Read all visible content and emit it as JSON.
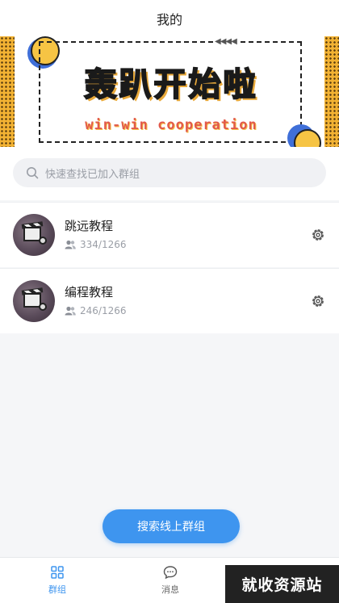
{
  "header": {
    "title": "我的"
  },
  "banner": {
    "headline": "轰趴开始啦",
    "subline": "win-win cooperation",
    "arrows": "◀◀◀◀"
  },
  "search": {
    "placeholder": "快速查找已加入群组"
  },
  "groups": [
    {
      "name": "跳远教程",
      "count": "334/1266",
      "icon": "film-clapper-avatar"
    },
    {
      "name": "编程教程",
      "count": "246/1266",
      "icon": "film-clapper-avatar"
    }
  ],
  "fab": {
    "label": "搜索线上群组"
  },
  "tabbar": {
    "items": [
      {
        "label": "群组",
        "icon": "grid-icon",
        "active": true
      },
      {
        "label": "消息",
        "icon": "chat-bubble-icon",
        "active": false
      }
    ]
  },
  "watermark": {
    "text": "就收资源站"
  },
  "colors": {
    "accent": "#3e95ef",
    "background": "#f5f6f8",
    "muted_text": "#9a9ea6"
  }
}
